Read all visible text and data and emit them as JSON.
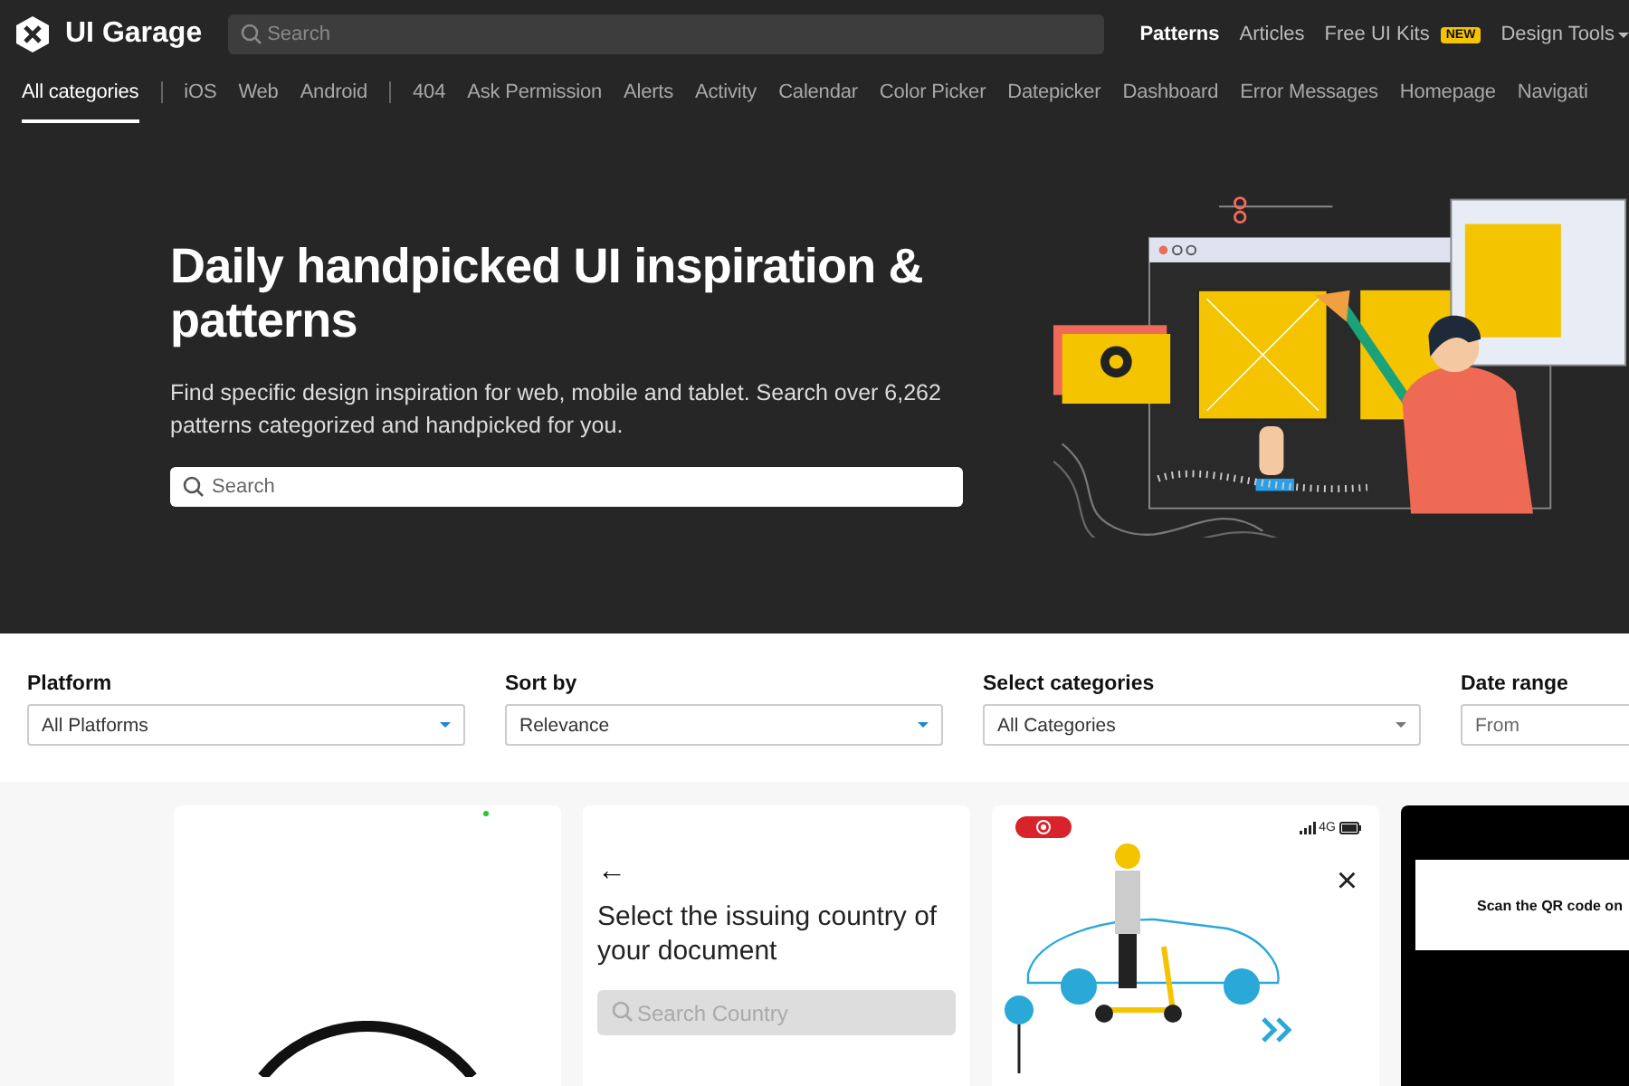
{
  "header": {
    "logo": "UI Garage",
    "search": {
      "placeholder": "Search"
    },
    "nav": [
      {
        "label": "Patterns",
        "selected": true
      },
      {
        "label": "Articles",
        "selected": false
      },
      {
        "label": "Free UI Kits",
        "selected": false,
        "badge": "NEW"
      },
      {
        "label": "Design Tools",
        "selected": false,
        "dropdown": true
      }
    ]
  },
  "category_groups": [
    {
      "items": [
        {
          "label": "All categories",
          "selected": true
        }
      ]
    },
    {
      "items": [
        {
          "label": "iOS",
          "selected": false
        },
        {
          "label": "Web",
          "selected": false
        },
        {
          "label": "Android",
          "selected": false
        }
      ]
    },
    {
      "items": [
        {
          "label": "404",
          "selected": false
        },
        {
          "label": "Ask Permission",
          "selected": false
        },
        {
          "label": "Alerts",
          "selected": false
        },
        {
          "label": "Activity",
          "selected": false
        },
        {
          "label": "Calendar",
          "selected": false
        },
        {
          "label": "Color Picker",
          "selected": false
        },
        {
          "label": "Datepicker",
          "selected": false
        },
        {
          "label": "Dashboard",
          "selected": false
        },
        {
          "label": "Error Messages",
          "selected": false
        },
        {
          "label": "Homepage",
          "selected": false
        },
        {
          "label": "Navigati",
          "selected": false
        }
      ]
    }
  ],
  "hero": {
    "title": "Daily handpicked UI inspiration & patterns",
    "description": "Find specific design inspiration for web, mobile and tablet. Search over 6,262 patterns categorized and handpicked for you.",
    "search": {
      "placeholder": "Search"
    }
  },
  "filters": [
    {
      "label": "Platform",
      "kind": "select",
      "value": "All Platforms"
    },
    {
      "label": "Sort by",
      "kind": "select",
      "value": "Relevance"
    },
    {
      "label": "Select categories",
      "kind": "select",
      "value": "All Categories"
    },
    {
      "label": "Date range",
      "kind": "input",
      "placeholder": "From"
    }
  ],
  "cards": [
    {
      "kind": "circle"
    },
    {
      "kind": "country",
      "back": "←",
      "title": "Select the issuing country of your document",
      "search": {
        "placeholder": "Search Country"
      }
    },
    {
      "kind": "scooter",
      "status": "4G",
      "close": "×"
    },
    {
      "kind": "qr",
      "text": "Scan the QR code on"
    }
  ]
}
